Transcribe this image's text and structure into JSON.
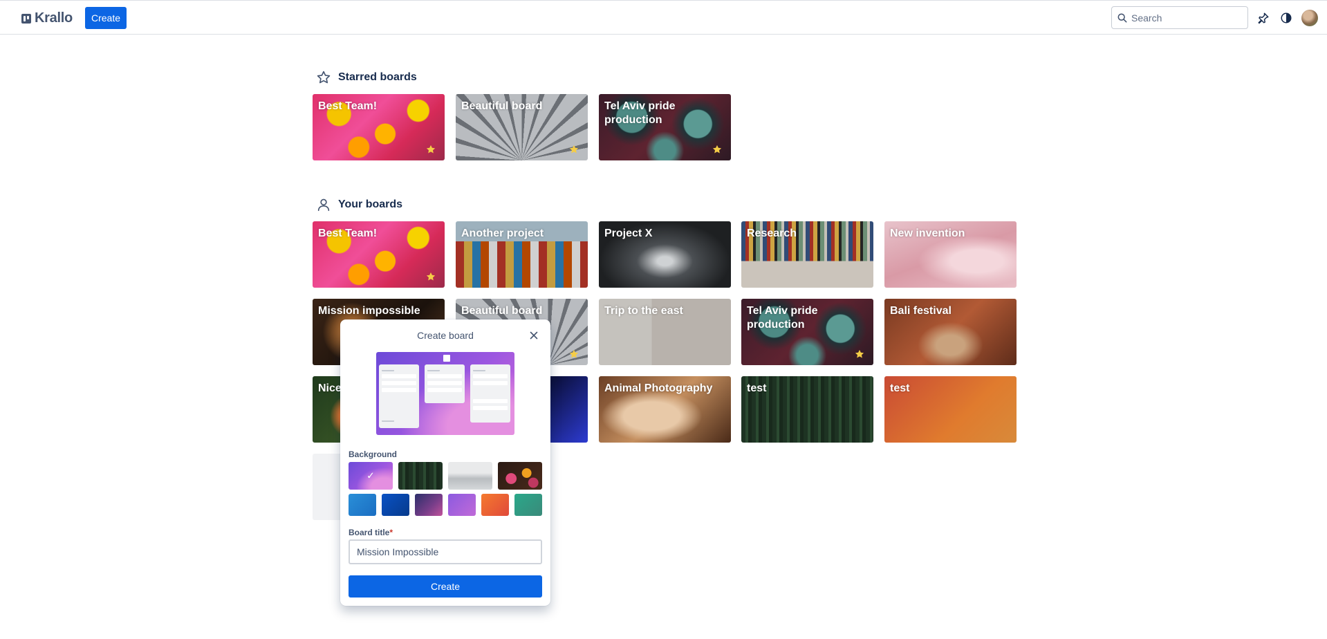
{
  "topbar": {
    "app_name": "Krallo",
    "create_label": "Create",
    "search_placeholder": "Search",
    "icons": [
      "search-icon",
      "pin-icon",
      "theme-toggle-icon"
    ]
  },
  "starred": {
    "heading": "Starred boards",
    "boards": [
      {
        "title": "Best Team!",
        "starred": true
      },
      {
        "title": "Beautiful board",
        "starred": true
      },
      {
        "title": "Tel Aviv pride production",
        "starred": true
      }
    ]
  },
  "yours": {
    "heading": "Your boards",
    "boards": [
      {
        "title": "Best Team!",
        "starred": true
      },
      {
        "title": "Another project",
        "starred": false
      },
      {
        "title": "Project X",
        "starred": false
      },
      {
        "title": "Research",
        "starred": false
      },
      {
        "title": "New invention",
        "starred": false
      },
      {
        "title": "Mission impossible",
        "starred": false
      },
      {
        "title": "Beautiful board",
        "starred": true
      },
      {
        "title": "Trip to the east",
        "starred": false
      },
      {
        "title": "Tel Aviv pride production",
        "starred": true
      },
      {
        "title": "Bali festival",
        "starred": false
      },
      {
        "title": "Nice",
        "starred": false
      },
      {
        "title": "",
        "starred": false
      },
      {
        "title": "Animal Photography",
        "starred": false
      },
      {
        "title": "test",
        "starred": false
      },
      {
        "title": "test",
        "starred": false
      }
    ]
  },
  "modal": {
    "title": "Create board",
    "background_label": "Background",
    "board_title_label": "Board title",
    "required_mark": "*",
    "board_title_value": "Mission Impossible",
    "create_label": "Create",
    "selected_background": "purple-waves",
    "check_mark": "✓",
    "colors": [
      "#1f86d2",
      "#0747a6",
      "#5b3a7a",
      "#a061d8",
      "#f06a36",
      "#2a9d8f"
    ]
  },
  "colors": {
    "accent": "#0c66e4",
    "star": "#f5cd47",
    "text": "#172b4d"
  }
}
